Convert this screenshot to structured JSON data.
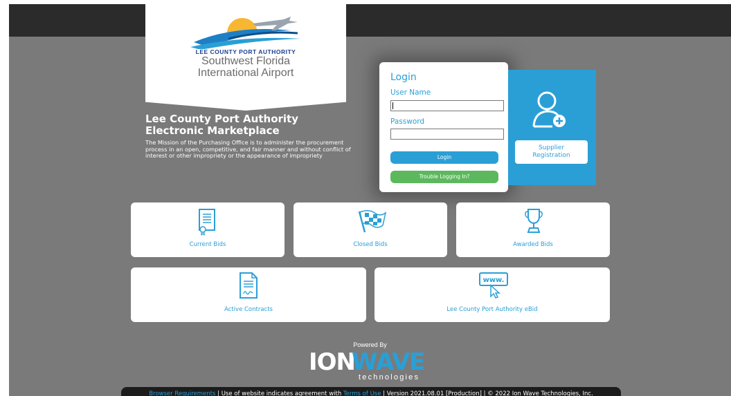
{
  "logo": {
    "line1": "LEE COUNTY PORT AUTHORITY",
    "line2": "Southwest Florida",
    "line3": "International Airport"
  },
  "intro": {
    "title_line1": "Lee County Port Authority",
    "title_line2": "Electronic Marketplace",
    "mission": "The Mission of the Purchasing Office is to administer the procurement process in an open, competitive, and fair manner and without conflict of interest or other impropriety or the appearance of impropriety"
  },
  "login": {
    "title": "Login",
    "username_label": "User Name",
    "username_value": "",
    "password_label": "Password",
    "password_value": "",
    "login_button": "Login",
    "trouble_button": "Trouble Logging In?"
  },
  "supplier": {
    "line1": "Supplier",
    "line2": "Registration"
  },
  "tiles": {
    "current_bids": "Current Bids",
    "closed_bids": "Closed Bids",
    "awarded_bids": "Awarded Bids",
    "active_contracts": "Active Contracts",
    "ebid": "Lee County Port Authority eBid",
    "www_icon_text": "www."
  },
  "footer": {
    "powered_by": "Powered By",
    "brand_ion": "ION",
    "brand_wave": "WAVE",
    "brand_tech": "technologies",
    "browser_requirements": "Browser Requirements",
    "sep1": " | Use of website indicates agreement with ",
    "terms_of_use": "Terms of Use",
    "version_info": " | Version 2021.08.01 [Production] | © 2022 Ion Wave Technologies, Inc."
  },
  "colors": {
    "accent": "#2a9fd6",
    "green": "#5cb85c",
    "background": "#7a7a7a",
    "topbar": "#2b2b2b"
  }
}
